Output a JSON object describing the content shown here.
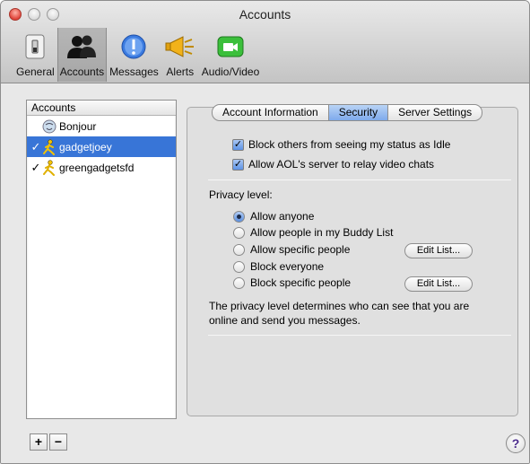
{
  "window": {
    "title": "Accounts"
  },
  "toolbar": {
    "items": [
      {
        "label": "General",
        "icon": "switch-icon"
      },
      {
        "label": "Accounts",
        "icon": "people-icon",
        "selected": true
      },
      {
        "label": "Messages",
        "icon": "message-icon"
      },
      {
        "label": "Alerts",
        "icon": "megaphone-icon"
      },
      {
        "label": "Audio/Video",
        "icon": "video-camera-icon"
      }
    ]
  },
  "accounts": {
    "header": "Accounts",
    "items": [
      {
        "name": "Bonjour",
        "checked": false,
        "icon": "bonjour-icon"
      },
      {
        "name": "gadgetjoey",
        "checked": true,
        "icon": "aim-runner-icon",
        "selected": true
      },
      {
        "name": "greengadgetsfd",
        "checked": true,
        "icon": "aim-runner-icon"
      }
    ],
    "add_label": "+",
    "remove_label": "−"
  },
  "tabs": [
    "Account Information",
    "Security",
    "Server Settings"
  ],
  "active_tab": "Security",
  "security": {
    "block_idle": {
      "label": "Block others from seeing my status as Idle",
      "checked": true
    },
    "relay_video": {
      "label": "Allow AOL's server to relay video chats",
      "checked": true
    },
    "privacy_label": "Privacy level:",
    "options": [
      {
        "label": "Allow anyone",
        "selected": true
      },
      {
        "label": "Allow people in my Buddy List",
        "selected": false
      },
      {
        "label": "Allow specific people",
        "selected": false
      },
      {
        "label": "Block everyone",
        "selected": false
      },
      {
        "label": "Block specific people",
        "selected": false
      }
    ],
    "edit_list_label": "Edit List...",
    "note_line1": "The privacy level determines who can see that you are",
    "note_line2": "online and send you messages."
  },
  "help_label": "?",
  "colors": {
    "selection": "#3875d7",
    "tab_active": "#7eaaec",
    "close_button": "#e0443a"
  }
}
